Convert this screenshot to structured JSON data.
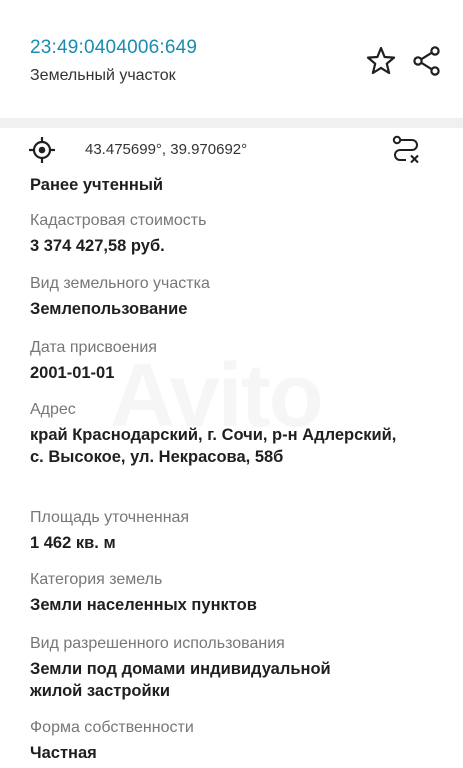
{
  "header": {
    "cadastral_number": "23:49:0404006:649",
    "object_type": "Земельный участок"
  },
  "coords": {
    "text": "43.475699°, 39.970692°"
  },
  "fields": {
    "status_value": "Ранее учтенный",
    "cost_label": "Кадастровая стоимость",
    "cost_value": "3 374 427,58 руб.",
    "land_kind_label": "Вид земельного участка",
    "land_kind_value": "Землепользование",
    "date_label": "Дата присвоения",
    "date_value": "2001-01-01",
    "address_label": "Адрес",
    "address_value": "край Краснодарский, г. Сочи, р-н Адлерский, с. Высокое, ул. Некрасова, 58б",
    "area_label": "Площадь уточненная",
    "area_value": "1 462 кв. м",
    "category_label": "Категория земель",
    "category_value": "Земли населенных пунктов",
    "usage_label": "Вид разрешенного использования",
    "usage_value": "Земли под домами индивидуальной жилой застройки",
    "ownership_label": "Форма собственности",
    "ownership_value": "Частная"
  },
  "icons": {
    "favorite": "star-icon",
    "share": "share-icon",
    "locate": "crosshair-icon",
    "route": "route-icon"
  },
  "colors": {
    "accent": "#1a8cae",
    "label": "#777777",
    "value": "#1f1f1f"
  }
}
